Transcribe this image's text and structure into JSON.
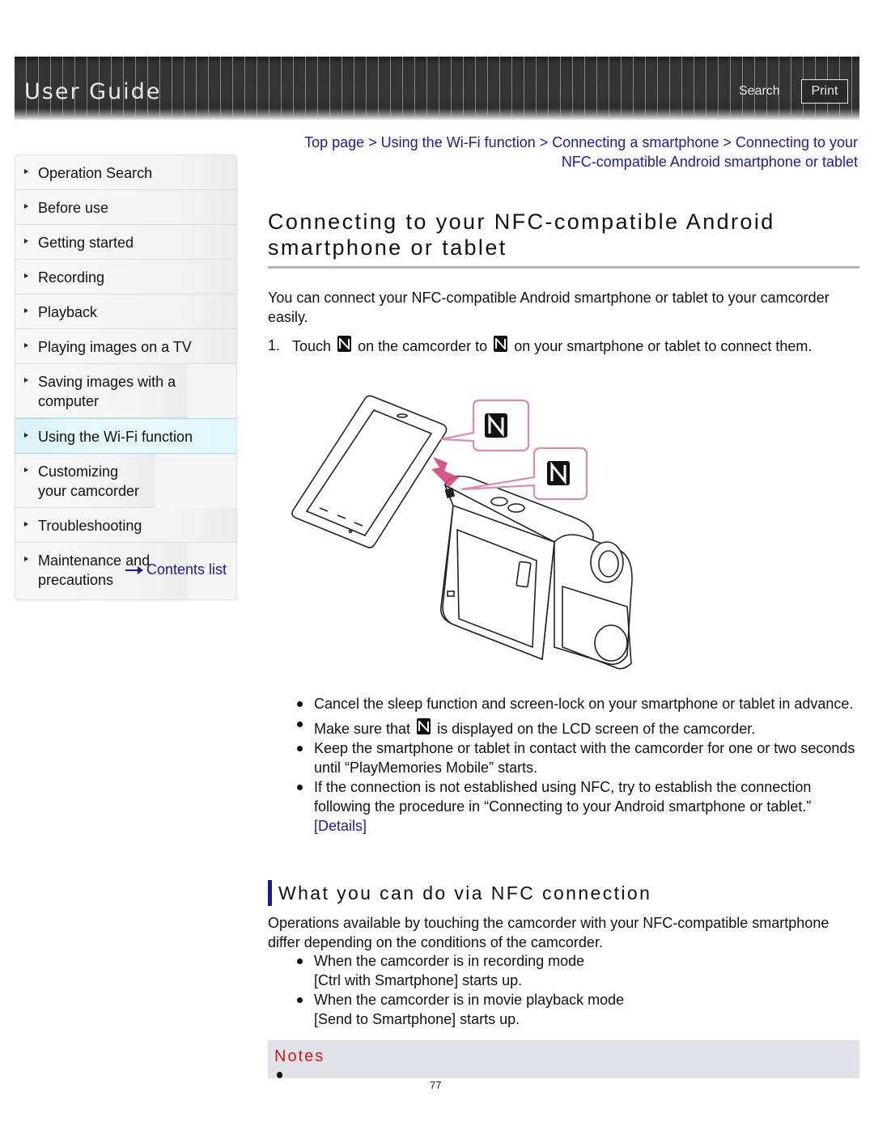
{
  "header": {
    "title": "User Guide",
    "search_label": "Search",
    "print_label": "Print"
  },
  "sidebar": {
    "items": [
      {
        "label": "Operation Search",
        "active": false
      },
      {
        "label": "Before use",
        "active": false
      },
      {
        "label": "Getting started",
        "active": false
      },
      {
        "label": "Recording",
        "active": false
      },
      {
        "label": "Playback",
        "active": false
      },
      {
        "label": "Playing images on a TV",
        "active": false
      },
      {
        "label": "Saving images with a computer",
        "active": false
      },
      {
        "label": "Using the Wi-Fi function",
        "active": true
      },
      {
        "label": "Customizing your camcorder",
        "active": false
      },
      {
        "label": "Troubleshooting",
        "active": false
      },
      {
        "label": "Maintenance and precautions",
        "active": false
      }
    ],
    "contents_link": "Contents list"
  },
  "breadcrumb": {
    "items": [
      "Top page",
      "Using the Wi-Fi function",
      "Connecting a smartphone",
      "Connecting to your NFC-compatible Android smartphone or tablet"
    ],
    "separator": " > "
  },
  "page": {
    "title": "Connecting to your NFC-compatible Android smartphone or tablet",
    "intro": "You can connect your NFC-compatible Android smartphone or tablet to your camcorder easily.",
    "step": {
      "number": "1.",
      "part1": "Touch",
      "part2": "on the camcorder to",
      "part3": "on your smartphone or tablet to connect them."
    },
    "illustration": {
      "description": "Smartphone touching NFC mark on camcorder",
      "icon": "nfc-n-mark-icon",
      "callout_color": "#d98cb0",
      "arrow_color": "#d4447c"
    },
    "bullets": [
      {
        "text": "Cancel the sleep function and screen-lock on your smartphone or tablet in advance."
      },
      {
        "before": "Make sure that",
        "after": "is displayed on the LCD screen of the camcorder."
      },
      {
        "text": "Keep the smartphone or tablet in contact with the camcorder for one or two seconds until “PlayMemories Mobile” starts."
      },
      {
        "text": "If the connection is not established using NFC, try to establish the connection following the procedure in “Connecting to your Android smartphone or tablet.”",
        "link": "[Details]"
      }
    ]
  },
  "section": {
    "heading": "What you can do via NFC connection",
    "body": "Operations available by touching the camcorder with your NFC-compatible smartphone differ depending on the conditions of the camcorder.",
    "items": [
      {
        "line1": "When the camcorder is in recording mode",
        "line2": "[Ctrl with Smartphone] starts up."
      },
      {
        "line1": "When the camcorder is in movie playback mode",
        "line2": "[Send to Smartphone] starts up."
      }
    ]
  },
  "notes": {
    "label": "Notes"
  },
  "page_number": "77",
  "colors": {
    "link": "#1a1aa6",
    "notes_label": "#d41616",
    "notes_bg": "#e0e2e6",
    "active_nav": "#dff7fb",
    "section_bar": "#1a1aa0"
  }
}
